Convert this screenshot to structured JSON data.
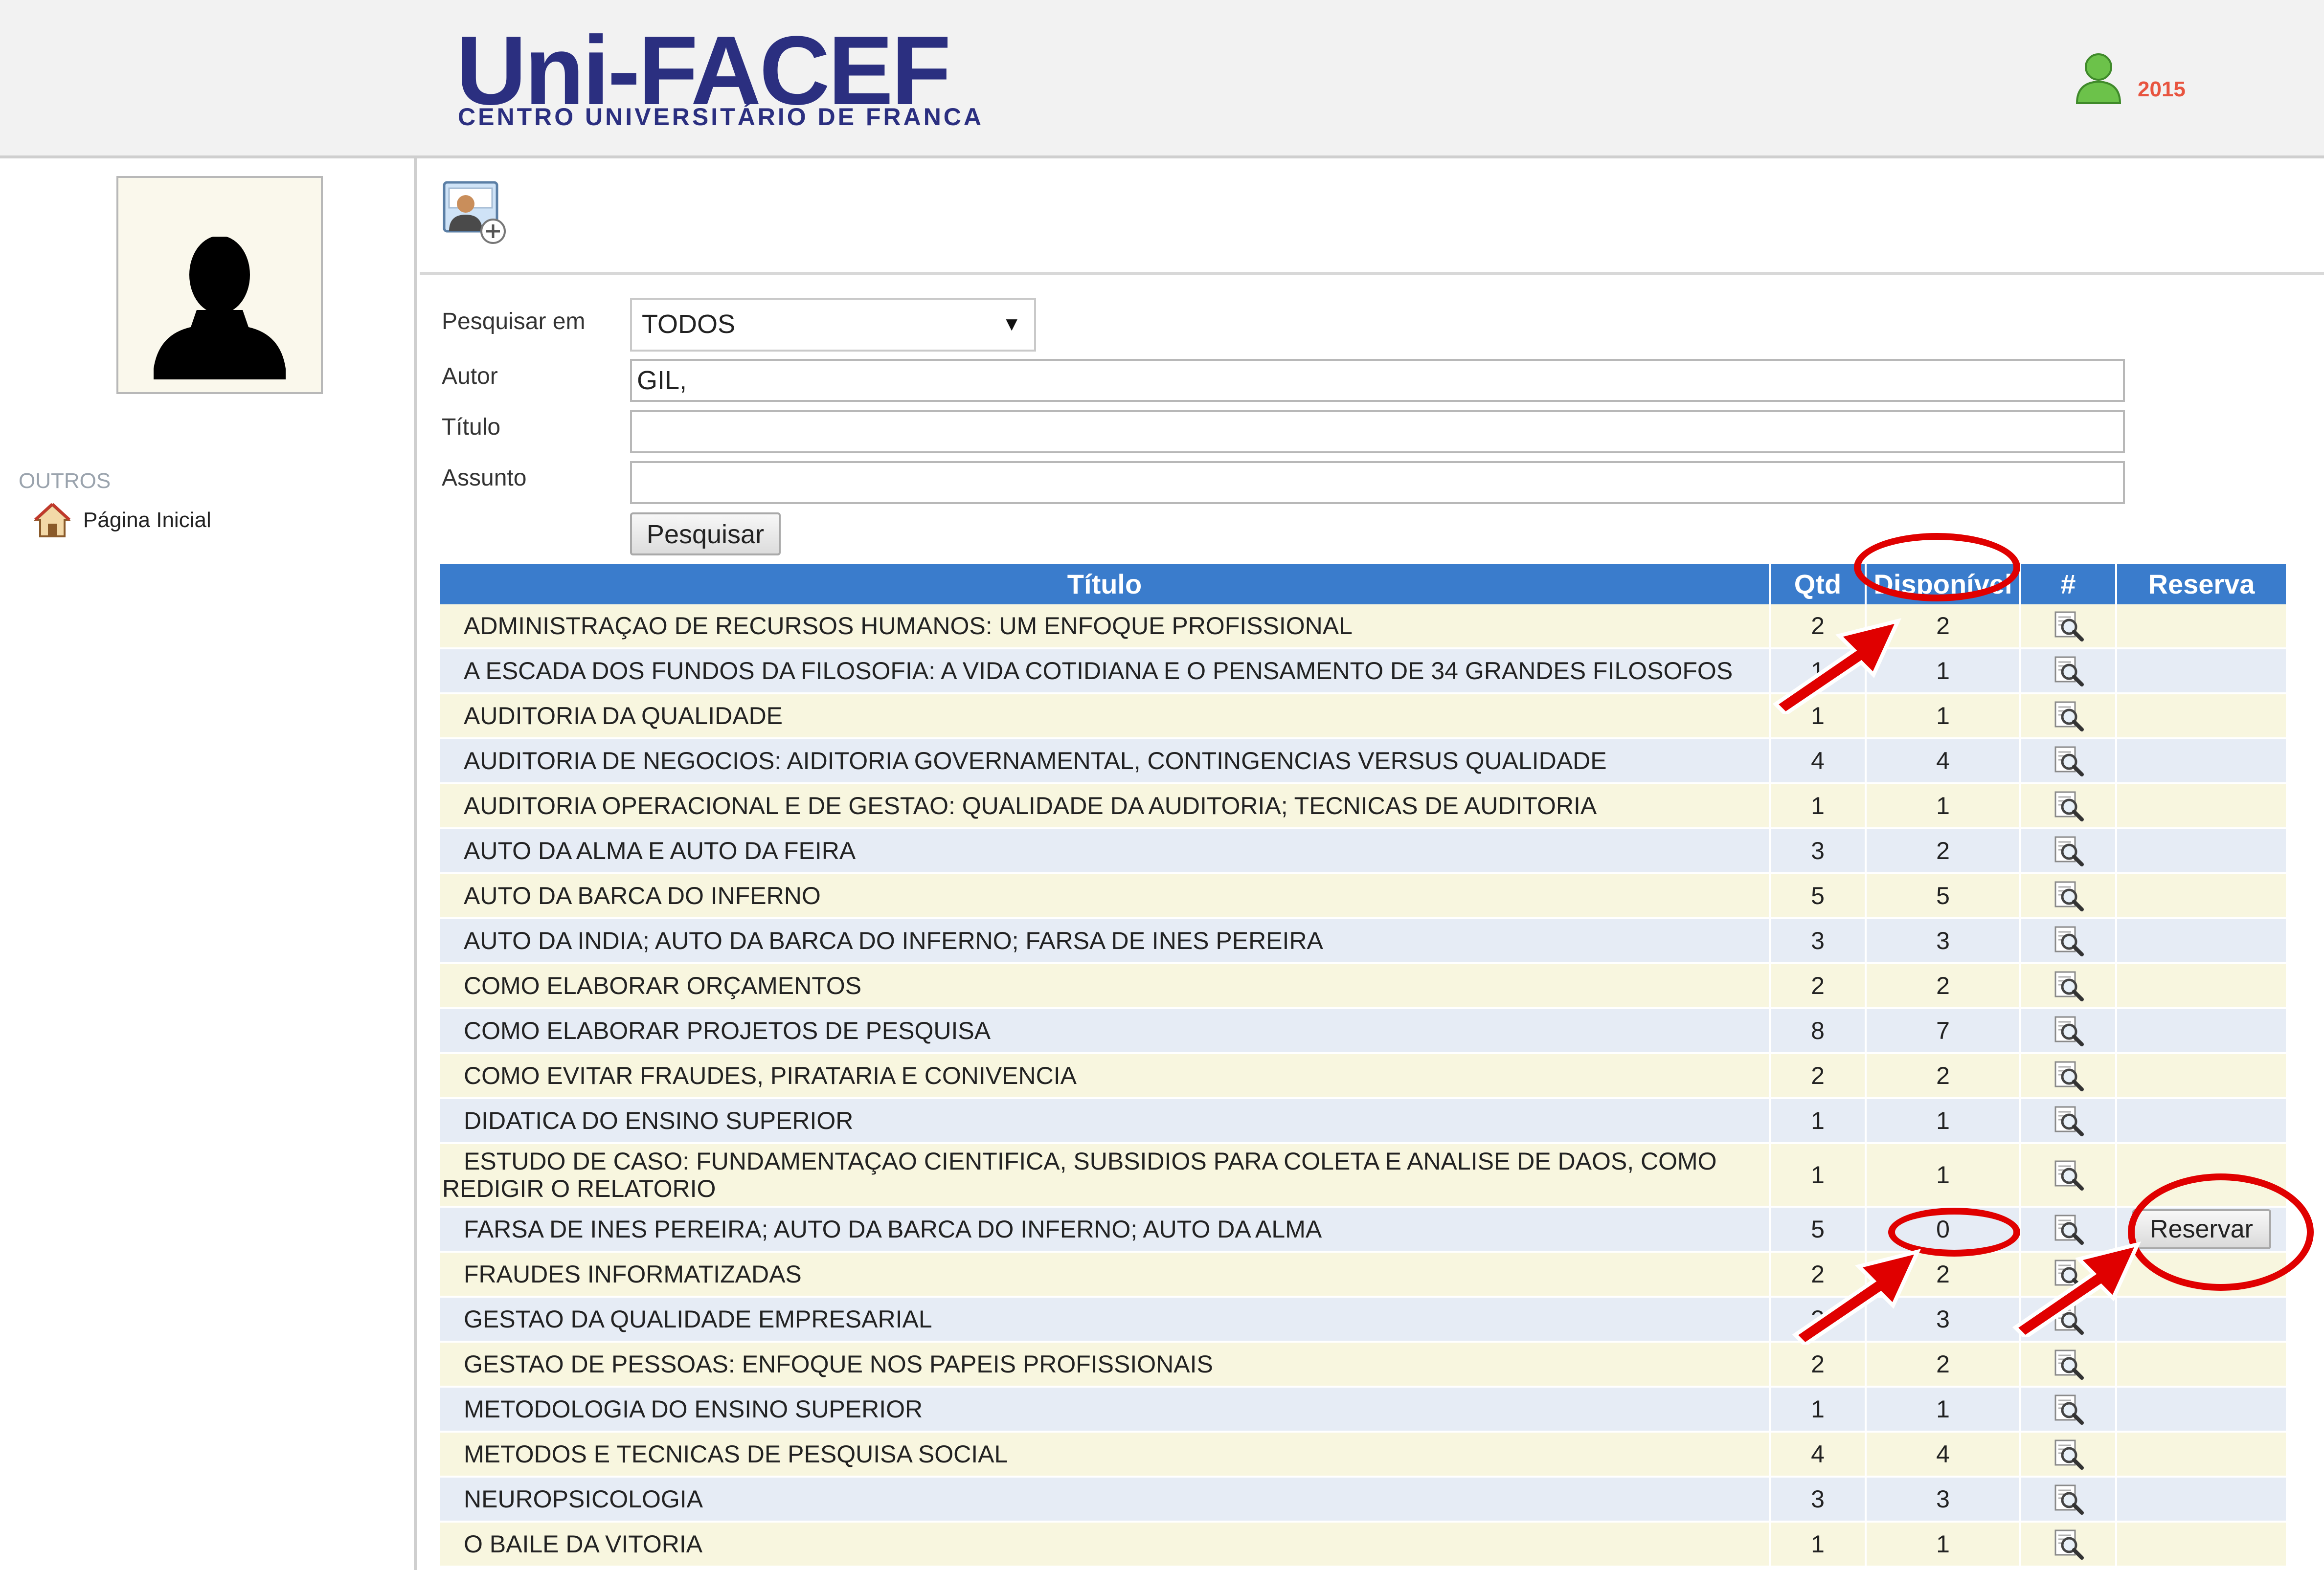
{
  "header": {
    "logo_main": "Uni-FACEF",
    "logo_sub": "CENTRO UNIVERSITÁRIO DE FRANCA",
    "user_year": "2015"
  },
  "sidebar": {
    "section_label": "OUTROS",
    "home_label": "Página Inicial"
  },
  "search": {
    "field_label": "Pesquisar em",
    "field_value": "TODOS",
    "author_label": "Autor",
    "author_value": "GIL,",
    "title_label": "Título",
    "title_value": "",
    "subject_label": "Assunto",
    "subject_value": "",
    "button_label": "Pesquisar"
  },
  "table": {
    "headers": {
      "title": "Título",
      "qtd": "Qtd",
      "disp": "Disponível",
      "view": "#",
      "reserve": "Reserva"
    },
    "reserve_button_label": "Reservar",
    "rows": [
      {
        "title": "ADMINISTRAÇAO DE RECURSOS HUMANOS: UM ENFOQUE PROFISSIONAL",
        "qtd": "2",
        "disp": "2"
      },
      {
        "title": "A ESCADA DOS FUNDOS DA FILOSOFIA: A VIDA COTIDIANA E O PENSAMENTO DE 34 GRANDES FILOSOFOS",
        "qtd": "1",
        "disp": "1"
      },
      {
        "title": "AUDITORIA DA QUALIDADE",
        "qtd": "1",
        "disp": "1"
      },
      {
        "title": "AUDITORIA DE NEGOCIOS: AIDITORIA GOVERNAMENTAL, CONTINGENCIAS VERSUS QUALIDADE",
        "qtd": "4",
        "disp": "4"
      },
      {
        "title": "AUDITORIA OPERACIONAL E DE GESTAO: QUALIDADE DA AUDITORIA; TECNICAS DE AUDITORIA",
        "qtd": "1",
        "disp": "1"
      },
      {
        "title": "AUTO DA ALMA E AUTO DA FEIRA",
        "qtd": "3",
        "disp": "2"
      },
      {
        "title": "AUTO DA BARCA DO INFERNO",
        "qtd": "5",
        "disp": "5"
      },
      {
        "title": "AUTO DA INDIA; AUTO DA BARCA DO INFERNO; FARSA DE INES PEREIRA",
        "qtd": "3",
        "disp": "3"
      },
      {
        "title": "COMO ELABORAR ORÇAMENTOS",
        "qtd": "2",
        "disp": "2"
      },
      {
        "title": "COMO ELABORAR PROJETOS DE PESQUISA",
        "qtd": "8",
        "disp": "7"
      },
      {
        "title": "COMO EVITAR FRAUDES, PIRATARIA E CONIVENCIA",
        "qtd": "2",
        "disp": "2"
      },
      {
        "title": "DIDATICA DO ENSINO SUPERIOR",
        "qtd": "1",
        "disp": "1"
      },
      {
        "title_line1": "ESTUDO DE CASO: FUNDAMENTAÇAO CIENTIFICA, SUBSIDIOS PARA COLETA E ANALISE DE DAOS, COMO",
        "title_line2": "REDIGIR O RELATORIO",
        "qtd": "1",
        "disp": "1"
      },
      {
        "title": "FARSA DE INES PEREIRA; AUTO DA BARCA DO INFERNO; AUTO DA ALMA",
        "qtd": "5",
        "disp": "0"
      },
      {
        "title": "FRAUDES INFORMATIZADAS",
        "qtd": "2",
        "disp": "2"
      },
      {
        "title": "GESTAO DA QUALIDADE EMPRESARIAL",
        "qtd": "3",
        "disp": "3"
      },
      {
        "title": "GESTAO DE PESSOAS: ENFOQUE NOS PAPEIS PROFISSIONAIS",
        "qtd": "2",
        "disp": "2"
      },
      {
        "title": "METODOLOGIA DO ENSINO SUPERIOR",
        "qtd": "1",
        "disp": "1"
      },
      {
        "title": "METODOS E TECNICAS DE PESQUISA SOCIAL",
        "qtd": "4",
        "disp": "4"
      },
      {
        "title": "NEUROPSICOLOGIA",
        "qtd": "3",
        "disp": "3"
      },
      {
        "title": "O BAILE DA VITORIA",
        "qtd": "1",
        "disp": "1"
      }
    ]
  },
  "colors": {
    "header_blue": "#3a7ccc",
    "logo_blue": "#2b2f80",
    "annotation_red": "#e00000",
    "year_red": "#e8543f"
  }
}
